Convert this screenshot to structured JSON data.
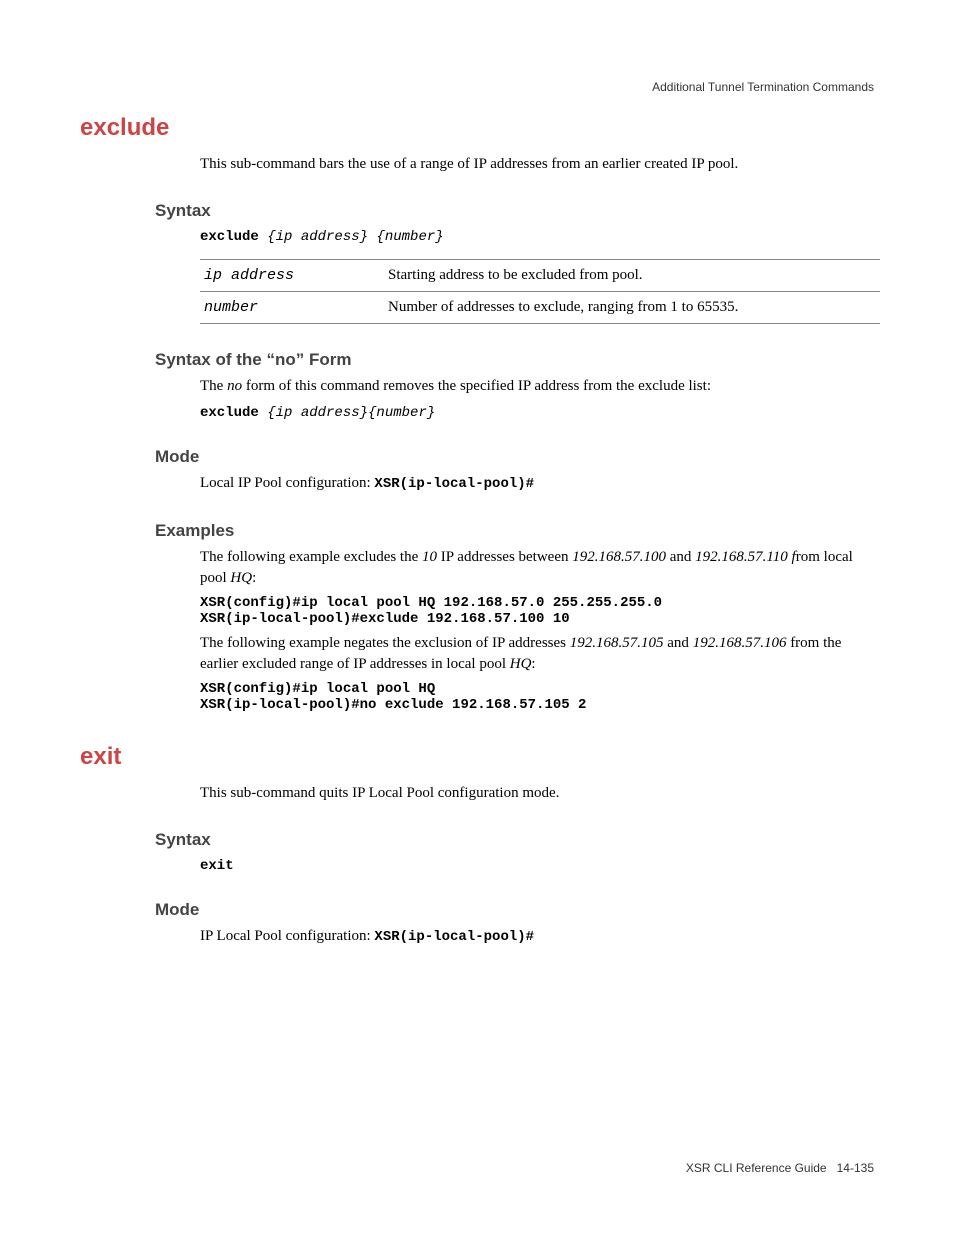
{
  "header": {
    "title": "Additional Tunnel Termination Commands"
  },
  "sections": {
    "exclude": {
      "title": "exclude",
      "intro": "This sub-command bars the use of a range of IP addresses from an earlier created IP pool.",
      "syntax": {
        "heading": "Syntax",
        "cmd_keyword": "exclude",
        "cmd_args": " {ip address} {number}",
        "params": [
          {
            "name": "ip address",
            "desc": "Starting address to be excluded from pool."
          },
          {
            "name": "number",
            "desc": "Number of addresses to exclude, ranging from 1 to 65535."
          }
        ]
      },
      "noform": {
        "heading": "Syntax of the “no” Form",
        "text_prefix": "The ",
        "text_em": "no",
        "text_suffix": " form of this command removes the specified IP address from the exclude list:",
        "cmd_keyword": "exclude",
        "cmd_args": " {ip address}{number}"
      },
      "mode": {
        "heading": "Mode",
        "text": "Local IP Pool configuration: ",
        "prompt": "XSR(ip-local-pool)#"
      },
      "examples": {
        "heading": "Examples",
        "p1_a": "The following example excludes the ",
        "p1_b": "10",
        "p1_c": " IP addresses between ",
        "p1_d": "192.168.57.100",
        "p1_e": " and ",
        "p1_f": "192.168.57.110 f",
        "p1_g": "rom local pool ",
        "p1_h": "HQ",
        "p1_i": ":",
        "code1_line1": "XSR(config)#ip local pool HQ 192.168.57.0 255.255.255.0",
        "code1_line2": "XSR(ip-local-pool)#exclude 192.168.57.100 10",
        "p2_a": "The following example negates the exclusion of IP addresses ",
        "p2_b": "192.168.57.105",
        "p2_c": " and ",
        "p2_d": "192.168.57.106",
        "p2_e": " from the earlier excluded range of IP addresses in local pool ",
        "p2_f": "HQ",
        "p2_g": ":",
        "code2_line1": "XSR(config)#ip local pool HQ",
        "code2_line2": "XSR(ip-local-pool)#no exclude 192.168.57.105 2"
      }
    },
    "exit": {
      "title": "exit",
      "intro": "This sub-command quits IP Local Pool configuration mode.",
      "syntax": {
        "heading": "Syntax",
        "cmd": "exit"
      },
      "mode": {
        "heading": "Mode",
        "text": "IP Local Pool configuration: ",
        "prompt": "XSR(ip-local-pool)#"
      }
    }
  },
  "footer": {
    "doc": "XSR CLI Reference Guide",
    "page": "14-135"
  }
}
